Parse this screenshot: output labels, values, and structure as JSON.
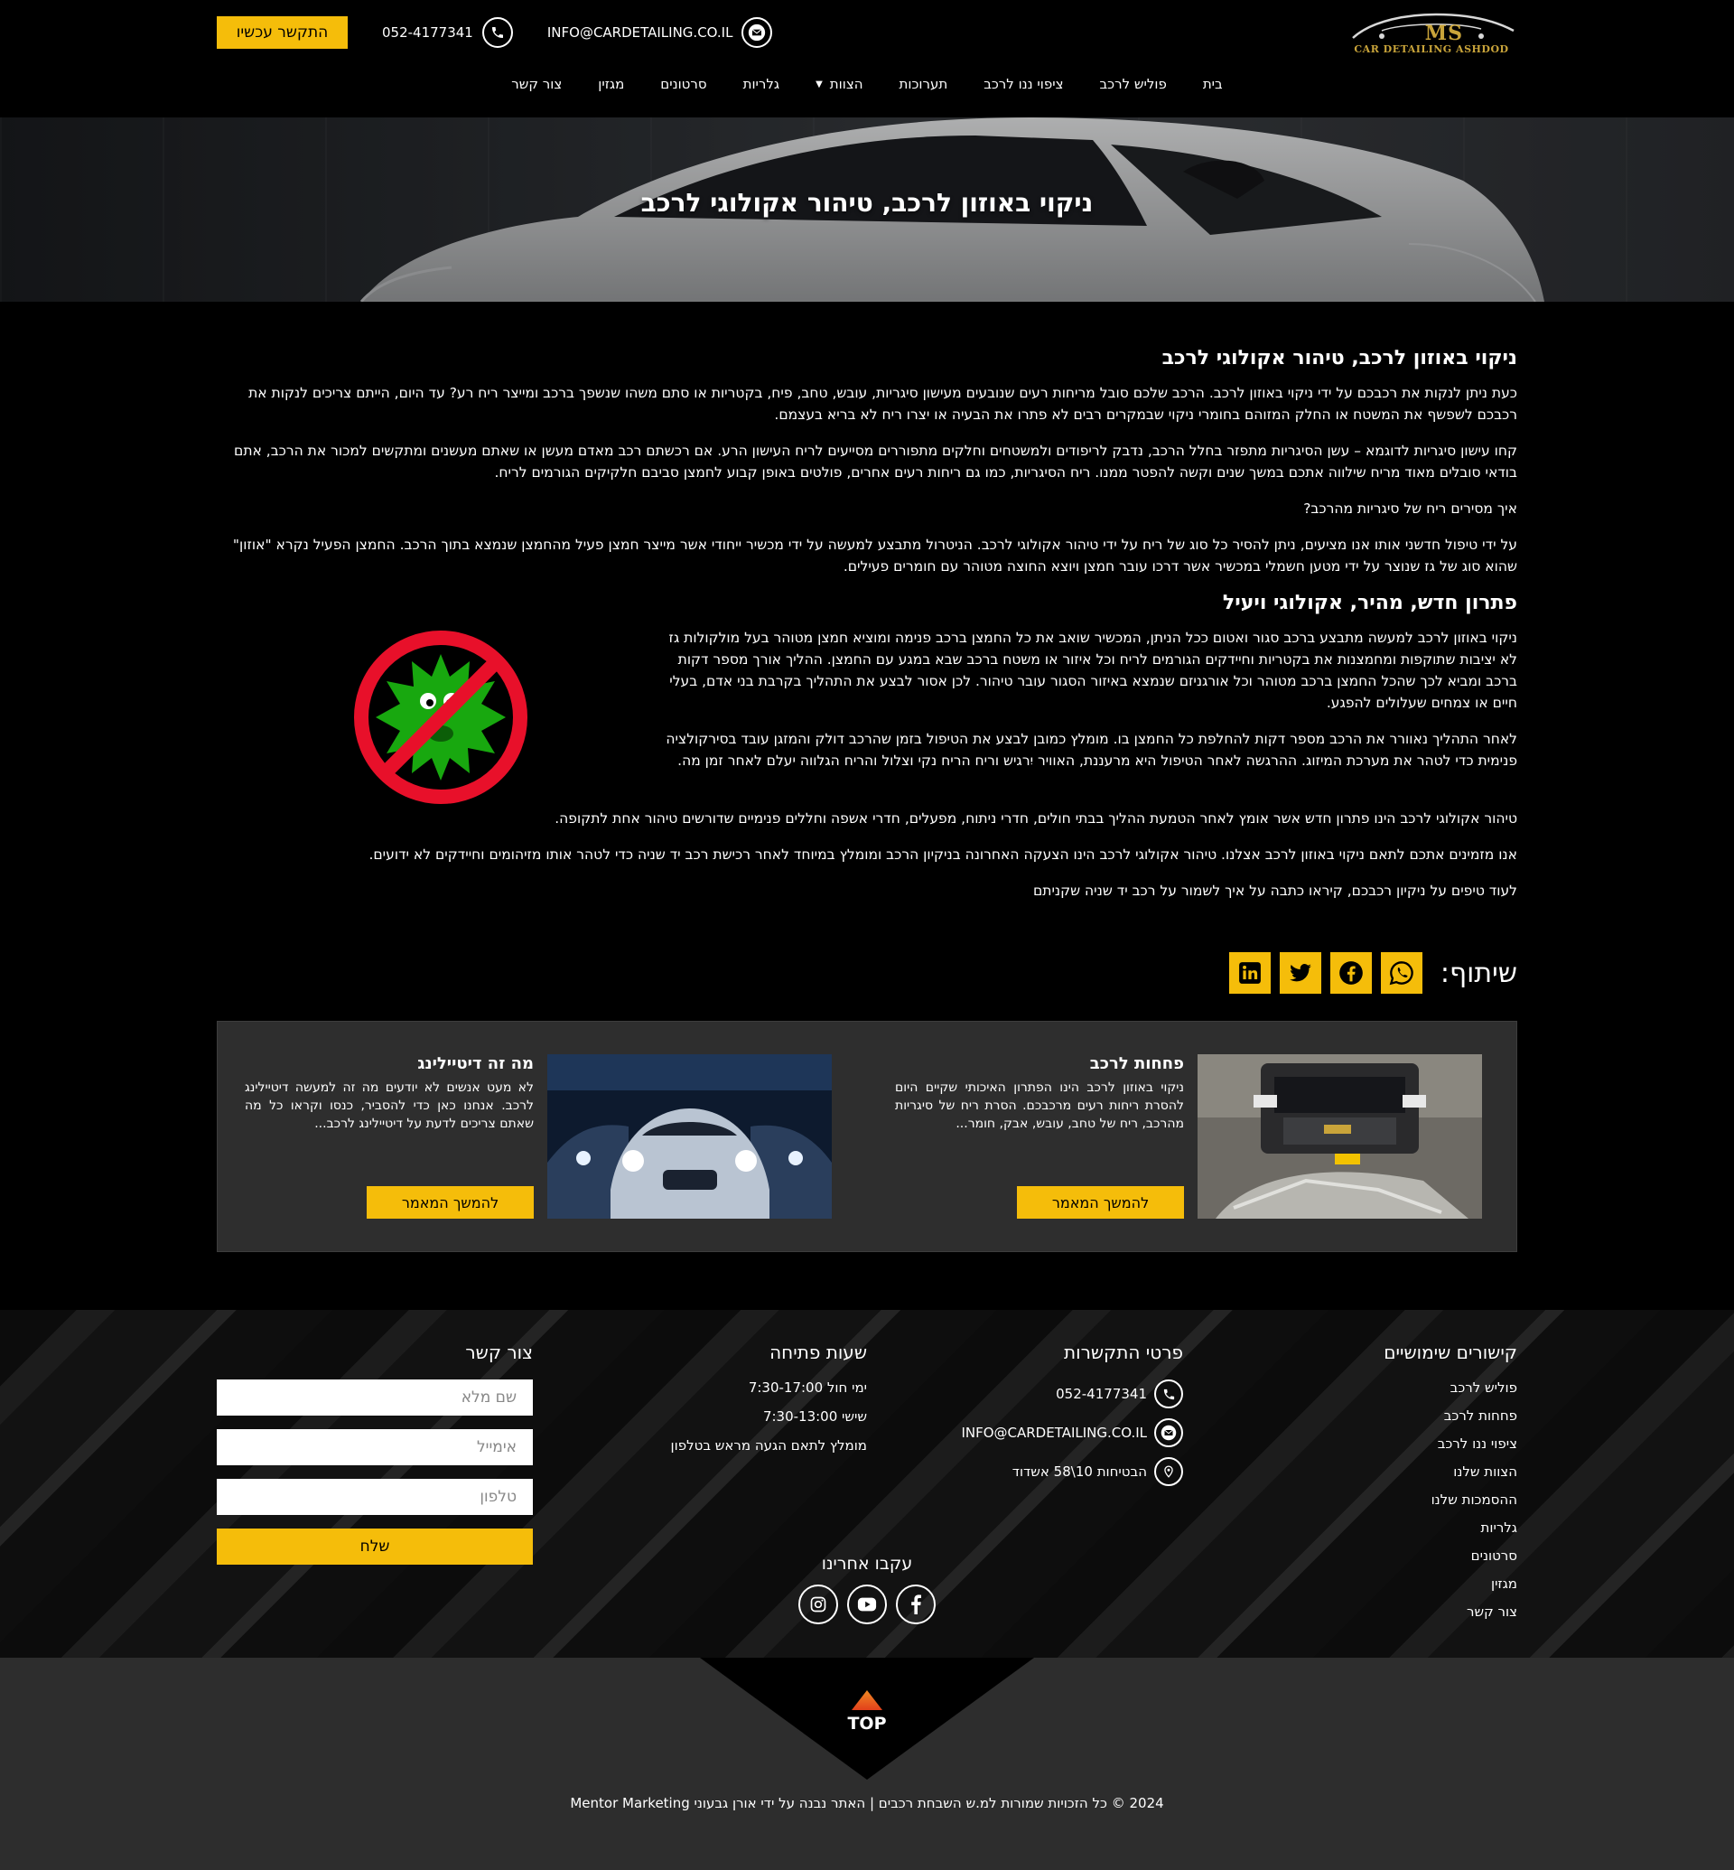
{
  "header": {
    "logo_text": "MS",
    "logo_sub": "CAR DETAILING ASHDOD",
    "cta_label": "התקשר עכשיו",
    "phone": "052-4177341",
    "email": "INFO@CARDETAILING.CO.IL",
    "nav": [
      {
        "label": "בית"
      },
      {
        "label": "פוליש לרכב"
      },
      {
        "label": "ציפוי ננו לרכב"
      },
      {
        "label": "תערוכות"
      },
      {
        "label": "הצוות"
      },
      {
        "label": "גלריות"
      },
      {
        "label": "סרטונים"
      },
      {
        "label": "מגזין"
      },
      {
        "label": "צור קשר"
      }
    ]
  },
  "hero": {
    "title": "ניקוי באוזון לרכב, טיהור אקולוגי לרכב"
  },
  "article": {
    "h1": "ניקוי באוזון לרכב, טיהור אקולוגי לרכב",
    "p1": "כעת ניתן לנקות את רכבכם על ידי ניקוי באוזון לרכב. הרכב שלכם סובל מריחות רעים שנובעים מעישון סיגריות, עובש, טחב, פיח, בקטריות או סתם משהו שנשפך ברכב ומייצר ריח רע? עד היום, הייתם צריכים לנקות את רכבכם לשפשף את המשטח או החלק המזוהם בחומרי ניקוי שבמקרים רבים לא פתרו את הבעיה או יצרו ריח לא בריא בעצמם.",
    "p2": "קחו עישון סיגריות לדוגמא – עשן הסיגריות מתפזר בחלל הרכב, נדבק לריפודים ולמשטחים וחלקים מתפוררים מסייעים לריח העישון הרע. אם רכשתם רכב מאדם מעשן או שאתם מעשנים ומתקשים למכור את הרכב, אתם בודאי סובלים מאוד מריח שילווה אתכם במשך שנים וקשה להפטר ממנו. ריח הסיגריות, כמו גם ריחות רעים אחרים, פולטים באופן קבוע לחמצן סביבם חלקיקים הגורמים לריח.",
    "p3": "איך מסירים ריח של סיגריות מהרכב?",
    "p4": "על ידי טיפול חדשני אותו אנו מציעים, ניתן להסיר כל סוג של ריח על ידי טיהור אקולוגי לרכב. הניטרול מתבצע למעשה על ידי מכשיר ייחודי אשר מייצר חמצן פעיל מהחמצן שנמצא בתוך הרכב. החמצן הפעיל נקרא \"אוזון\" שהוא סוג של גז שנוצר על ידי מטען חשמלי במכשיר אשר דרכו עובר חמצן ויוצא החוצה מטוהר עם חומרים פעילים.",
    "h2": "פתרון חדש, מהיר, אקולוגי ויעיל",
    "p5": "ניקוי באוזון לרכב למעשה מתבצע ברכב סגור ואטום ככל הניתן, המכשיר שואב את כל החמצן ברכב פנימה ומוציא חמצן מטוהר בעל מולקולות גז לא יציבות שתוקפות ומחמצנות את בקטריות וחיידקים הגורמים לריח וכל איזור או משטח ברכב שבא במגע עם החמצן. ההליך אורך מספר דקות ברכב ומביא לכך שהכל החמצן ברכב מטוהר וכל אורגניזם שנמצא באיזור הסגור עובר טיהור. לכן אסור לבצע את התהליך בקרבת בני אדם, בעלי חיים או צמחים שעלולים להפגע.",
    "p6": "לאחר התהליך נאוורר את הרכב מספר דקות להחלפת כל החמצן בו. מומלץ כמובן לבצע את הטיפול בזמן שהרכב דולק והמזגן עובד בסירקולציה פנימית כדי לטהר את מערכת המיזוג. ההרגשה לאחר הטיפול היא מרעננת, האוויר יִרגיש וריח הריח נקי וצלול והריח הגלווה יעלם לאחר זמן מה.",
    "p7": "טיהור אקולוגי לרכב הינו פתרון חדש אשר אומץ לאחר הטמעת ההליך בבתי חולים, חדרי ניתוח, מפעלים, חדרי אשפה וחללים פנימיים שדורשים טיהור אחת לתקופה.",
    "p8": "אנו מזמינים אתכם לתאם ניקוי באוזון לרכב אצלנו. טיהור אקולוגי לרכב הינו הצעקה האחרונה בניקיון הרכב ומומלץ במיוחד לאחר רכישת רכב יד שניה כדי לטהר אותו מזיהומים וחיידקים לא ידועים.",
    "p9": "לעוד טיפים על ניקיון רכבכם, קיראו כתבה על איך לשמור על רכב יד שניה שקניתם"
  },
  "share": {
    "label": "שיתוף:"
  },
  "related": [
    {
      "title": "פחחות לרכב",
      "text": "ניקוי באוזון לרכב הינו הפתרון האיכותי שקיים היום להסרת ריחות רעים מרכבכם. הסרת ריח של סיגריות מהרכב, ריח של טחב, עובש, אבק, חומר...",
      "button": "להמשך המאמר"
    },
    {
      "title": "מה זה דיטיילינג",
      "text": "לא מעט אנשים לא יודעים מה זה למעשה דיטיילינג לרכב. אנחנו כאן כדי להסביר, כנסו וקראו כל מה שאתם צריכים לדעת על דיטיילינג לרכב...",
      "button": "להמשך המאמר"
    }
  ],
  "footer": {
    "links_title": "קישורים שימושיים",
    "links": [
      "פוליש לרכב",
      "פחחות לרכב",
      "ציפוי ננו לרכב",
      "הצוות שלנו",
      "ההסמכות שלנו",
      "גלריות",
      "סרטונים",
      "מגזין",
      "צור קשר"
    ],
    "contact_title": "פרטי התקשרות",
    "phone": "052-4177341",
    "email": "INFO@CARDETAILING.CO.IL",
    "address": "הבטיחות 10\\58 אשדוד",
    "hours_title": "שעות פתיחה",
    "hours": [
      "ימי חול 7:30-17:00",
      "שישי 7:30-13:00",
      "מומלץ לתאם הגעה מראש בטלפון"
    ],
    "form_title": "צור קשר",
    "form_name_placeholder": "שם מלא",
    "form_email_placeholder": "אימייל",
    "form_phone_placeholder": "טלפון",
    "form_submit": "שלח",
    "follow_title": "עקבו אחרינו"
  },
  "bottom": {
    "top_label": "TOP",
    "copyright": "2024 © כל הזכויות שמורות למ.ש השבחת רכבים | האתר נבנה על ידי אורן גבעוני Mentor Marketing"
  },
  "colors": {
    "accent": "#f5bd0a",
    "background": "#000000",
    "card": "#2e2e2e"
  }
}
